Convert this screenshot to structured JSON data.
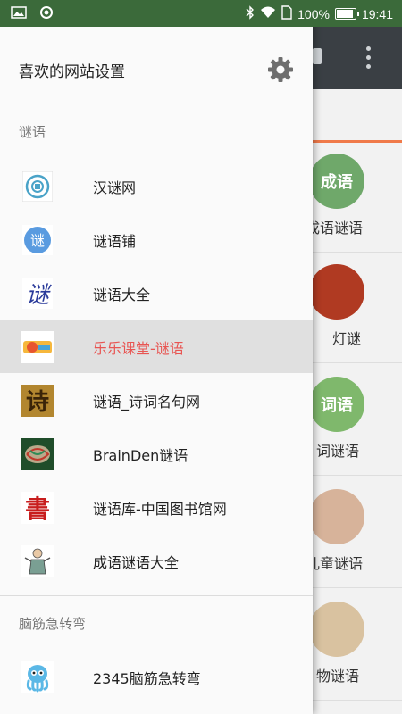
{
  "status_bar": {
    "battery": "100%",
    "battery_level": 1.0,
    "time": "19:41"
  },
  "drawer": {
    "title": "喜欢的网站设置",
    "settings_icon": "gear-icon",
    "sections": [
      {
        "header": "谜语",
        "items": [
          {
            "label": "汉谜网",
            "icon": "hanmi-logo-icon"
          },
          {
            "label": "谜语铺",
            "icon": "miyupu-logo-icon"
          },
          {
            "label": "谜语大全",
            "icon": "miyu-daquan-logo-icon"
          },
          {
            "label": "乐乐课堂-谜语",
            "icon": "lele-ketang-logo-icon",
            "selected": true
          },
          {
            "label": "谜语_诗词名句网",
            "icon": "shici-logo-icon"
          },
          {
            "label": "BrainDen谜语",
            "icon": "brainden-logo-icon"
          },
          {
            "label": "谜语库-中国图书馆网",
            "icon": "library-logo-icon"
          },
          {
            "label": "成语谜语大全",
            "icon": "chengyu-figure-icon"
          }
        ]
      },
      {
        "header": "脑筋急转弯",
        "items": [
          {
            "label": "2345脑筋急转弯",
            "icon": "octopus-logo-icon"
          }
        ]
      }
    ]
  },
  "background_app": {
    "items": [
      {
        "label": "成语谜语",
        "badge": "成语"
      },
      {
        "label": "灯谜",
        "badge": ""
      },
      {
        "label": "词谜语",
        "badge": "词语"
      },
      {
        "label": "儿童谜语",
        "badge": ""
      },
      {
        "label": "物谜语",
        "badge": ""
      }
    ]
  },
  "colors": {
    "accent": "#e85552",
    "selected_bg": "#e0e0e0",
    "status_bar": "#3b6a3a",
    "app_bar": "#3a3f44"
  }
}
